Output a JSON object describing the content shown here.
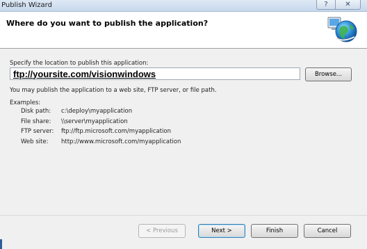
{
  "window": {
    "title": "Publish Wizard",
    "help_glyph": "?",
    "close_glyph": "✕"
  },
  "header": {
    "title": "Where do you want to publish the application?",
    "icon": "globe-network-icon"
  },
  "location": {
    "label": "Specify the location to publish this application:",
    "value": "ftp://yoursite.com/visionwindows",
    "browse_label": "Browse..."
  },
  "info": {
    "text": "You may publish the application to a web site, FTP server, or file path.",
    "examples_label": "Examples:",
    "examples": [
      {
        "key": "Disk path:",
        "value": "c:\\deploy\\myapplication"
      },
      {
        "key": "File share:",
        "value": "\\\\server\\myapplication"
      },
      {
        "key": "FTP server:",
        "value": "ftp://ftp.microsoft.com/myapplication"
      },
      {
        "key": "Web site:",
        "value": "http://www.microsoft.com/myapplication"
      }
    ]
  },
  "buttons": {
    "previous": "< Previous",
    "next": "Next >",
    "finish": "Finish",
    "cancel": "Cancel"
  }
}
